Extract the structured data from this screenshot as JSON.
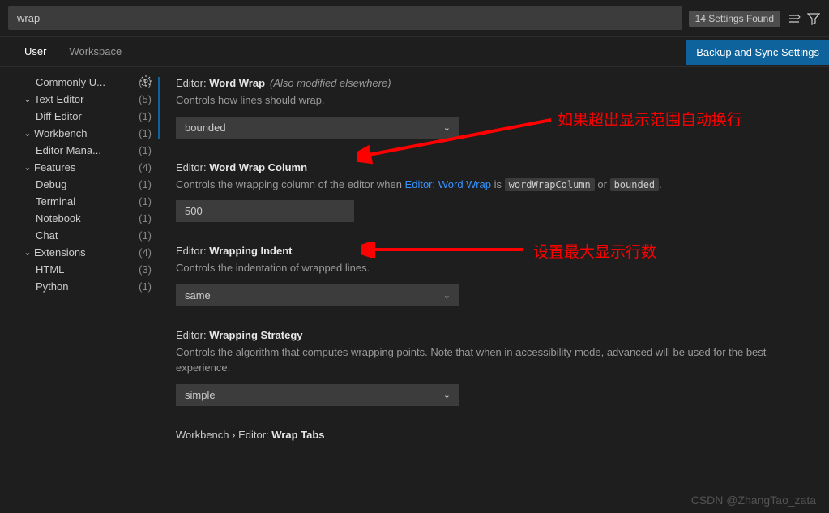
{
  "search": {
    "value": "wrap",
    "found_badge": "14 Settings Found"
  },
  "tabs": {
    "user": "User",
    "workspace": "Workspace",
    "sync_button": "Backup and Sync Settings"
  },
  "sidebar": {
    "commonly_used": "Commonly U...",
    "commonly_used_count": "(1)",
    "text_editor": "Text Editor",
    "text_editor_count": "(5)",
    "diff_editor": "Diff Editor",
    "diff_editor_count": "(1)",
    "workbench": "Workbench",
    "workbench_count": "(1)",
    "editor_mgmt": "Editor Mana...",
    "editor_mgmt_count": "(1)",
    "features": "Features",
    "features_count": "(4)",
    "debug": "Debug",
    "debug_count": "(1)",
    "terminal": "Terminal",
    "terminal_count": "(1)",
    "notebook": "Notebook",
    "notebook_count": "(1)",
    "chat": "Chat",
    "chat_count": "(1)",
    "extensions": "Extensions",
    "extensions_count": "(4)",
    "html": "HTML",
    "html_count": "(3)",
    "python": "Python",
    "python_count": "(1)"
  },
  "settings": {
    "word_wrap": {
      "prefix": "Editor: ",
      "title": "Word Wrap",
      "hint": "(Also modified elsewhere)",
      "desc": "Controls how lines should wrap.",
      "value": "bounded"
    },
    "word_wrap_column": {
      "prefix": "Editor: ",
      "title": "Word Wrap Column",
      "desc_1": "Controls the wrapping column of the editor when ",
      "desc_link": "Editor: Word Wrap",
      "desc_2": " is ",
      "code1": "wordWrapColumn",
      "desc_3": " or ",
      "code2": "bounded",
      "desc_4": ".",
      "value": "500"
    },
    "wrapping_indent": {
      "prefix": "Editor: ",
      "title": "Wrapping Indent",
      "desc": "Controls the indentation of wrapped lines.",
      "value": "same"
    },
    "wrapping_strategy": {
      "prefix": "Editor: ",
      "title": "Wrapping Strategy",
      "desc": "Controls the algorithm that computes wrapping points. Note that when in accessibility mode, advanced will be used for the best experience.",
      "value": "simple"
    },
    "wrap_tabs": {
      "prefix": "Workbench › Editor: ",
      "title": "Wrap Tabs"
    }
  },
  "annotations": {
    "a1": "如果超出显示范围自动换行",
    "a2": "设置最大显示行数"
  },
  "watermark": "CSDN @ZhangTao_zata"
}
